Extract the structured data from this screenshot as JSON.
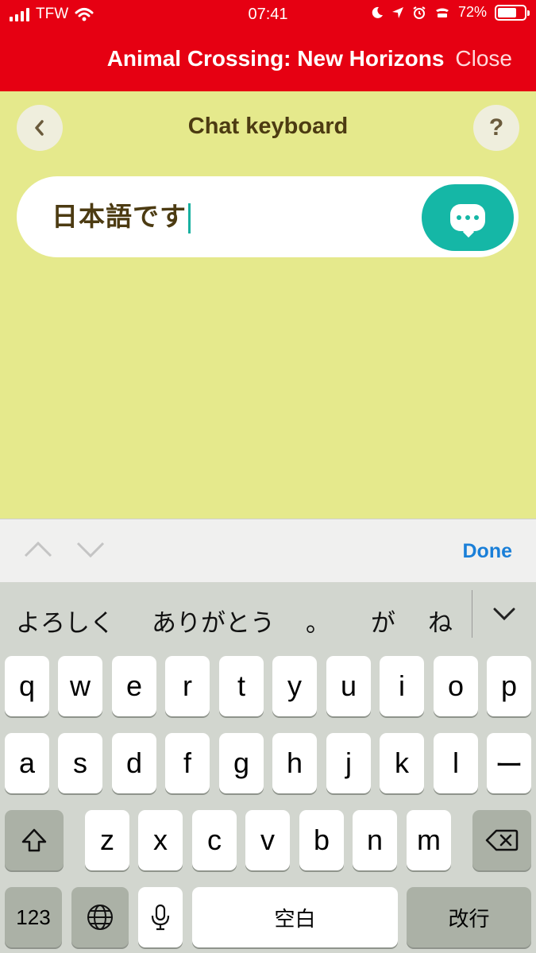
{
  "status_bar": {
    "carrier": "TFW",
    "time": "07:41",
    "battery": "72%",
    "battery_level": 0.72
  },
  "app_bar": {
    "title": "Animal Crossing: New Horizons",
    "close_label": "Close"
  },
  "header": {
    "back_icon": "chevron-left-icon",
    "title": "Chat keyboard",
    "help_label": "?"
  },
  "chat_input": {
    "value": "日本語です",
    "send_icon": "chat-bubble-icon"
  },
  "accessory_bar": {
    "prev_icon": "chevron-up-icon",
    "next_icon": "chevron-down-icon",
    "done_label": "Done"
  },
  "keyboard": {
    "candidates": [
      "よろしく",
      "ありがとう",
      "。",
      "が",
      "ね"
    ],
    "row1": [
      "q",
      "w",
      "e",
      "r",
      "t",
      "y",
      "u",
      "i",
      "o",
      "p"
    ],
    "row2": [
      "a",
      "s",
      "d",
      "f",
      "g",
      "h",
      "j",
      "k",
      "l",
      "ー"
    ],
    "row3": [
      "z",
      "x",
      "c",
      "v",
      "b",
      "n",
      "m"
    ],
    "numbers_label": "123",
    "space_label": "空白",
    "return_label": "改行",
    "colors": {
      "key": "#ffffff",
      "special_key": "#abb1a6",
      "background": "#d2d6cf"
    }
  },
  "colors": {
    "app_bar": "#e60012",
    "background": "#e5e98c",
    "accent": "#15b7a6",
    "done": "#1a7fd8"
  }
}
